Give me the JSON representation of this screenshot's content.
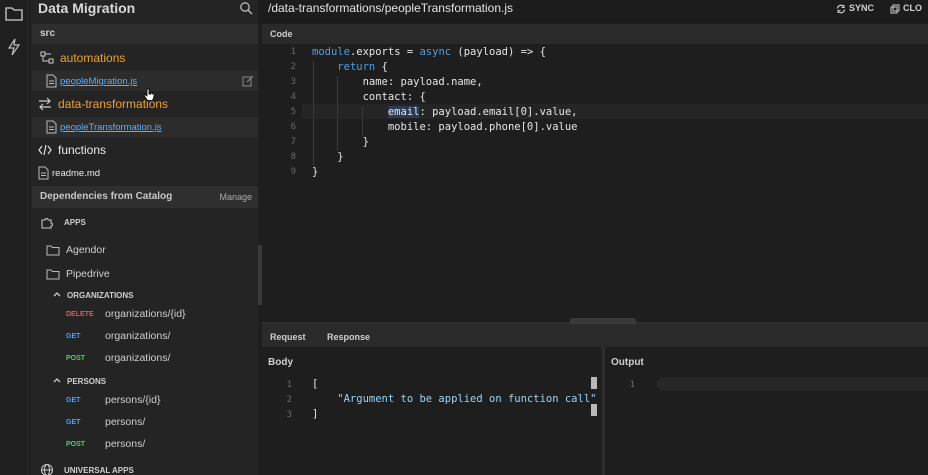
{
  "sidebar": {
    "title": "Data Migration",
    "section": "src",
    "tree": [
      {
        "label": "automations",
        "type": "folder"
      },
      {
        "label": "peopleMigration.js",
        "type": "file"
      },
      {
        "label": "data-transformations",
        "type": "folder"
      },
      {
        "label": "peopleTransformation.js",
        "type": "file"
      },
      {
        "label": "functions",
        "type": "folder"
      },
      {
        "label": "readme.md",
        "type": "file"
      }
    ],
    "dependencies": {
      "title": "Dependencies from Catalog",
      "manage": "Manage",
      "apps_label": "APPS",
      "apps": [
        "Agendor",
        "Pipedrive"
      ],
      "organizations_label": "ORGANIZATIONS",
      "organizations": [
        {
          "method": "DELETE",
          "path": "organizations/{id}"
        },
        {
          "method": "GET",
          "path": "organizations/"
        },
        {
          "method": "POST",
          "path": "organizations/"
        }
      ],
      "persons_label": "PERSONS",
      "persons": [
        {
          "method": "GET",
          "path": "persons/{id}"
        },
        {
          "method": "GET",
          "path": "persons/"
        },
        {
          "method": "POST",
          "path": "persons/"
        }
      ],
      "universal_label": "UNIVERSAL APPS"
    }
  },
  "editor": {
    "path": "/data-transformations/peopleTransformation.js",
    "sync_label": "SYNC",
    "close_label": "CLO",
    "tab": "Code",
    "line_numbers": [
      "1",
      "2",
      "3",
      "4",
      "5",
      "6",
      "7",
      "8",
      "9"
    ],
    "lines": [
      "module.exports = async (payload) => {",
      "    return {",
      "        name: payload.name,",
      "        contact: {",
      "            email: payload.email[0].value,",
      "            mobile: payload.phone[0].value",
      "        }",
      "    }",
      "}"
    ]
  },
  "bottom": {
    "tabs": [
      "Request",
      "Response"
    ],
    "body_title": "Body",
    "output_title": "Output",
    "body_line_numbers": [
      "1",
      "2",
      "3"
    ],
    "body_lines": [
      "[",
      "    \"Argument to be applied on function call\"",
      "]"
    ],
    "output_line_numbers": [
      "1"
    ]
  },
  "colors": {
    "folder_orange": "#f0a030",
    "link_blue": "#5ab0ff",
    "delete_red": "#e05a5a",
    "get_blue": "#4aa0ff",
    "post_green": "#4ccf70"
  }
}
